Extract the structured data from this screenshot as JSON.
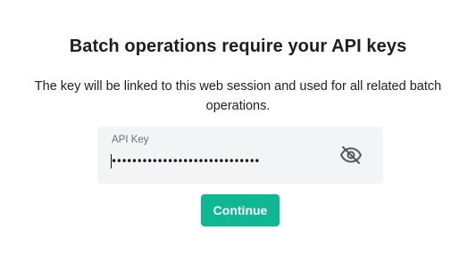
{
  "heading": "Batch operations require your API keys",
  "description": "The key will be linked to this web session and used for all related batch operations.",
  "api_key_field": {
    "label": "API Key",
    "masked_value": "•••••••••••••••••••••••••••••",
    "toggle_icon": "eye-off-icon"
  },
  "continue_button": {
    "label": "Continue",
    "color": "#0fb893"
  }
}
